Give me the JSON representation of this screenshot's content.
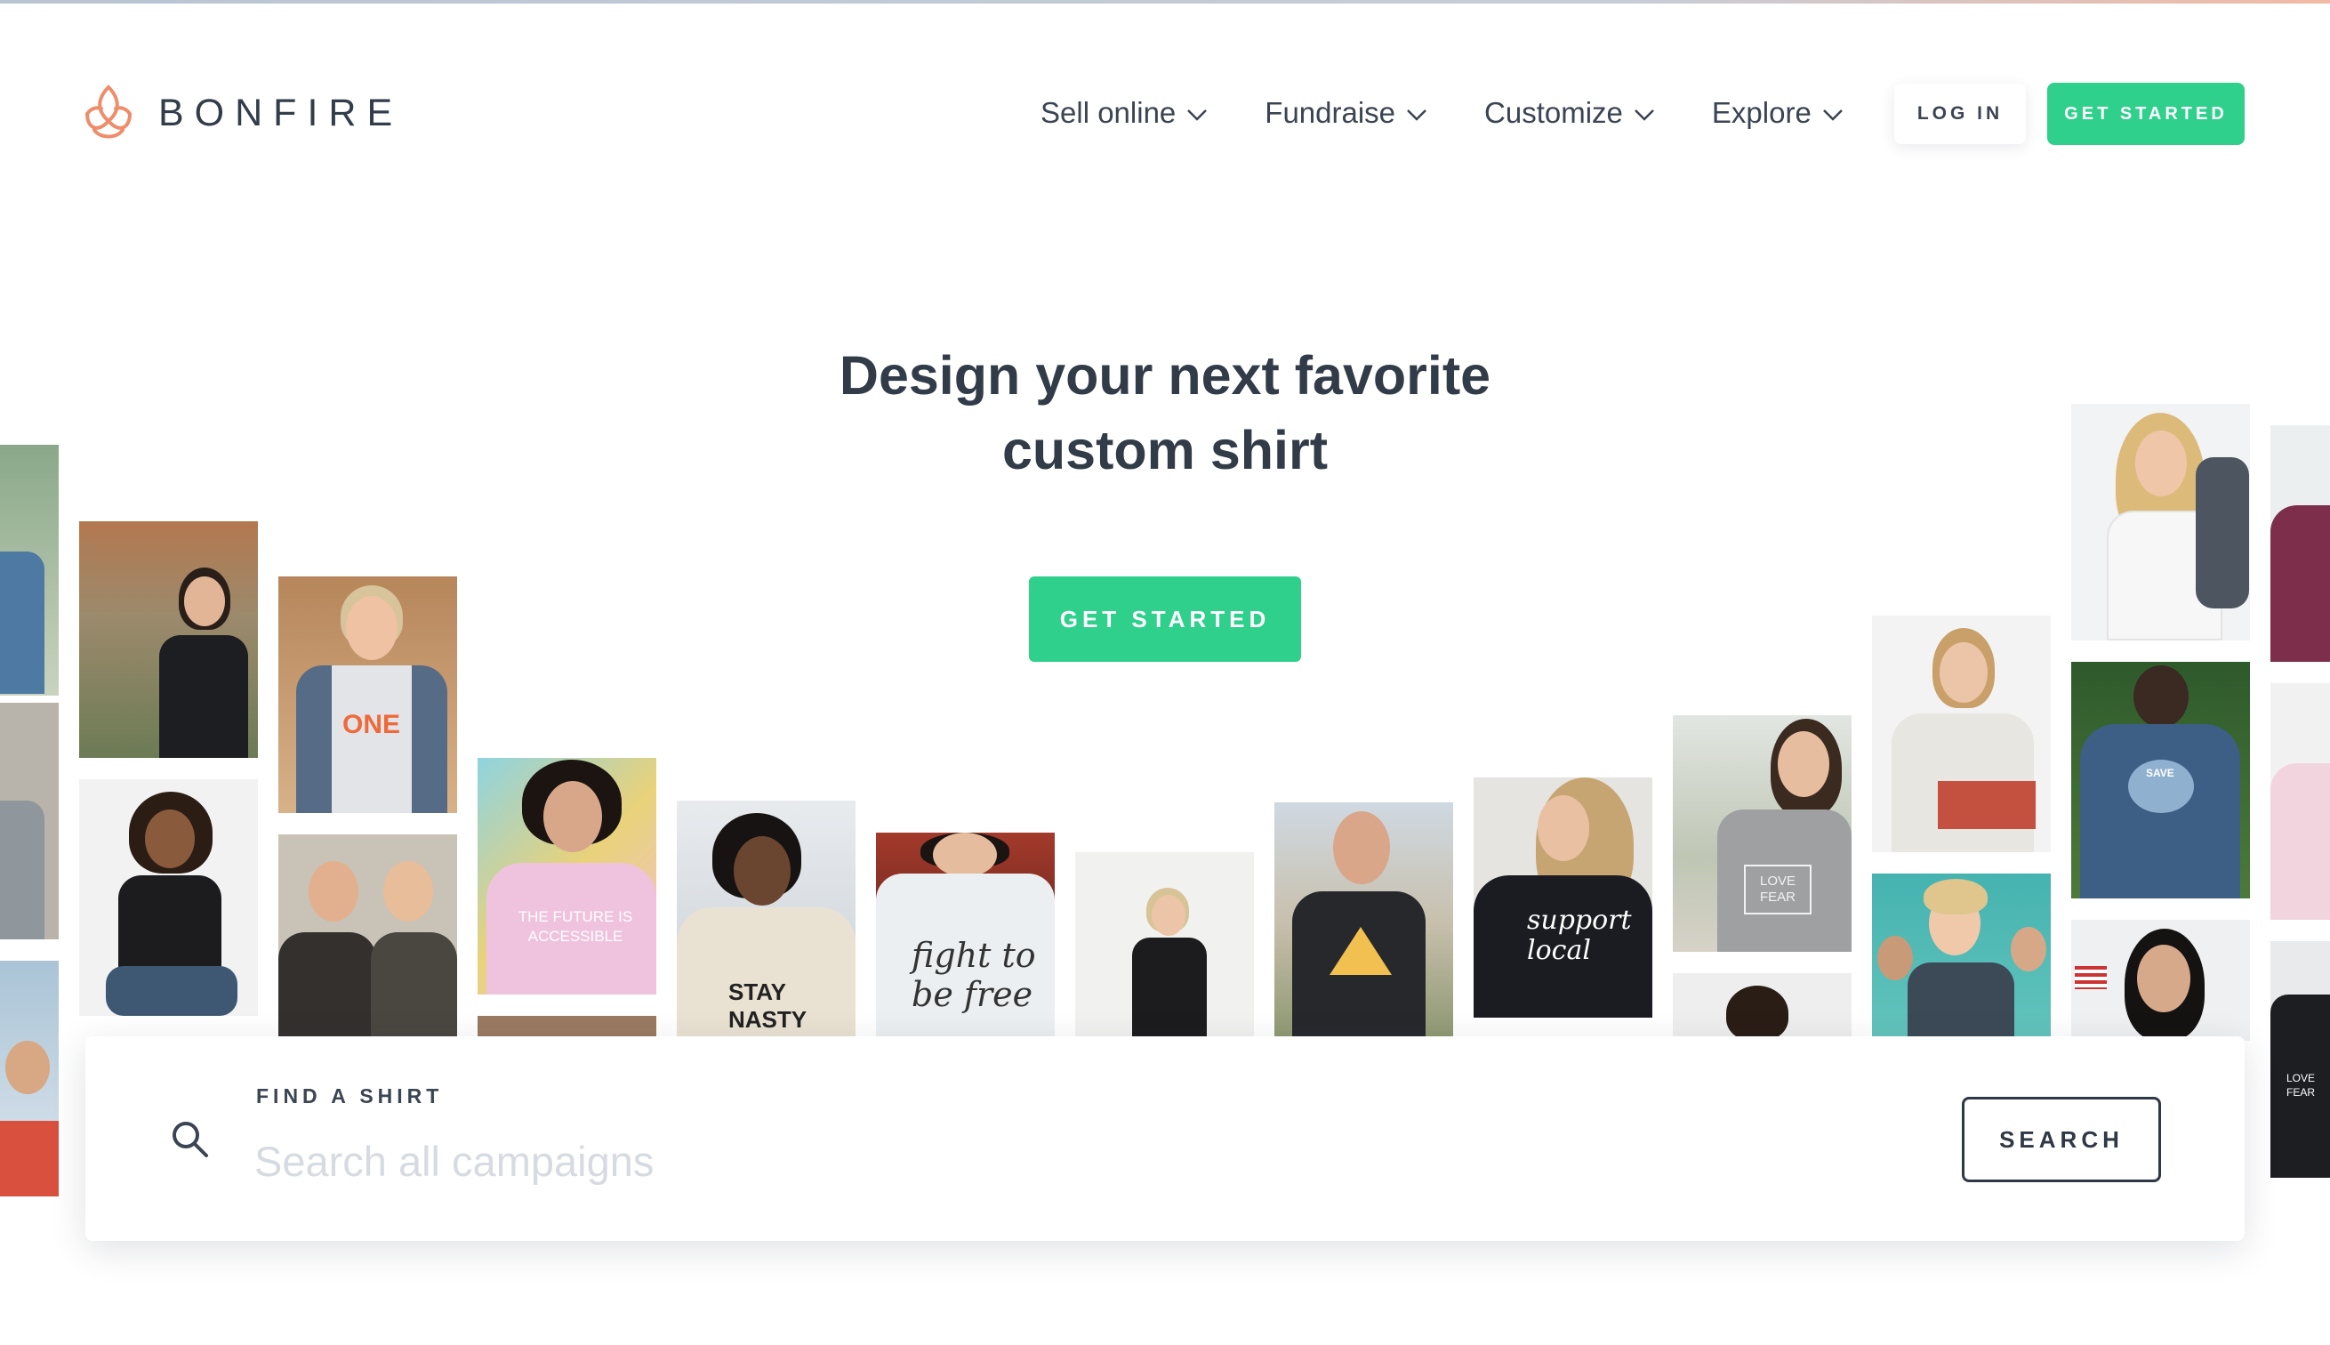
{
  "brand": {
    "name": "BONFIRE",
    "accent": "#2fcf8c",
    "logo_color": "#ef8c6a",
    "icon": "flame-petal-icon"
  },
  "nav": {
    "items": [
      {
        "label": "Sell online",
        "icon": "chevron-down-icon"
      },
      {
        "label": "Fundraise",
        "icon": "chevron-down-icon"
      },
      {
        "label": "Customize",
        "icon": "chevron-down-icon"
      },
      {
        "label": "Explore",
        "icon": "chevron-down-icon"
      }
    ],
    "login_label": "LOG IN",
    "signup_label": "GET STARTED"
  },
  "hero": {
    "title_line1": "Design your next favorite",
    "title_line2": "custom shirt",
    "cta_label": "GET STARTED"
  },
  "gallery": {
    "tiles": [
      {
        "name": "photo-tile",
        "shirt_text": ""
      },
      {
        "name": "photo-tile",
        "shirt_text": ""
      },
      {
        "name": "photo-tile",
        "shirt_text": ""
      },
      {
        "name": "photo-tile",
        "shirt_text": ""
      },
      {
        "name": "photo-tile",
        "shirt_text": ""
      },
      {
        "name": "photo-tile",
        "shirt_text": "ONE"
      },
      {
        "name": "photo-tile",
        "shirt_text": ""
      },
      {
        "name": "photo-tile",
        "shirt_text": "THE FUTURE IS ACCESSIBLE"
      },
      {
        "name": "photo-tile",
        "shirt_text": "STAY NASTY"
      },
      {
        "name": "photo-tile",
        "shirt_text": "fight to be free"
      },
      {
        "name": "photo-tile",
        "shirt_text": ""
      },
      {
        "name": "photo-tile",
        "shirt_text": ""
      },
      {
        "name": "photo-tile",
        "shirt_text": "support local"
      },
      {
        "name": "photo-tile",
        "shirt_text": "LOVE FEAR"
      },
      {
        "name": "photo-tile",
        "shirt_text": ""
      },
      {
        "name": "photo-tile",
        "shirt_text": ""
      },
      {
        "name": "photo-tile",
        "shirt_text": ""
      },
      {
        "name": "photo-tile",
        "shirt_text": "SAVE"
      },
      {
        "name": "photo-tile",
        "shirt_text": ""
      },
      {
        "name": "photo-tile",
        "shirt_text": "LOVE FEAR"
      }
    ]
  },
  "search": {
    "label": "FIND A SHIRT",
    "placeholder": "Search all campaigns",
    "value": "",
    "button_label": "SEARCH",
    "icon": "search-icon"
  }
}
